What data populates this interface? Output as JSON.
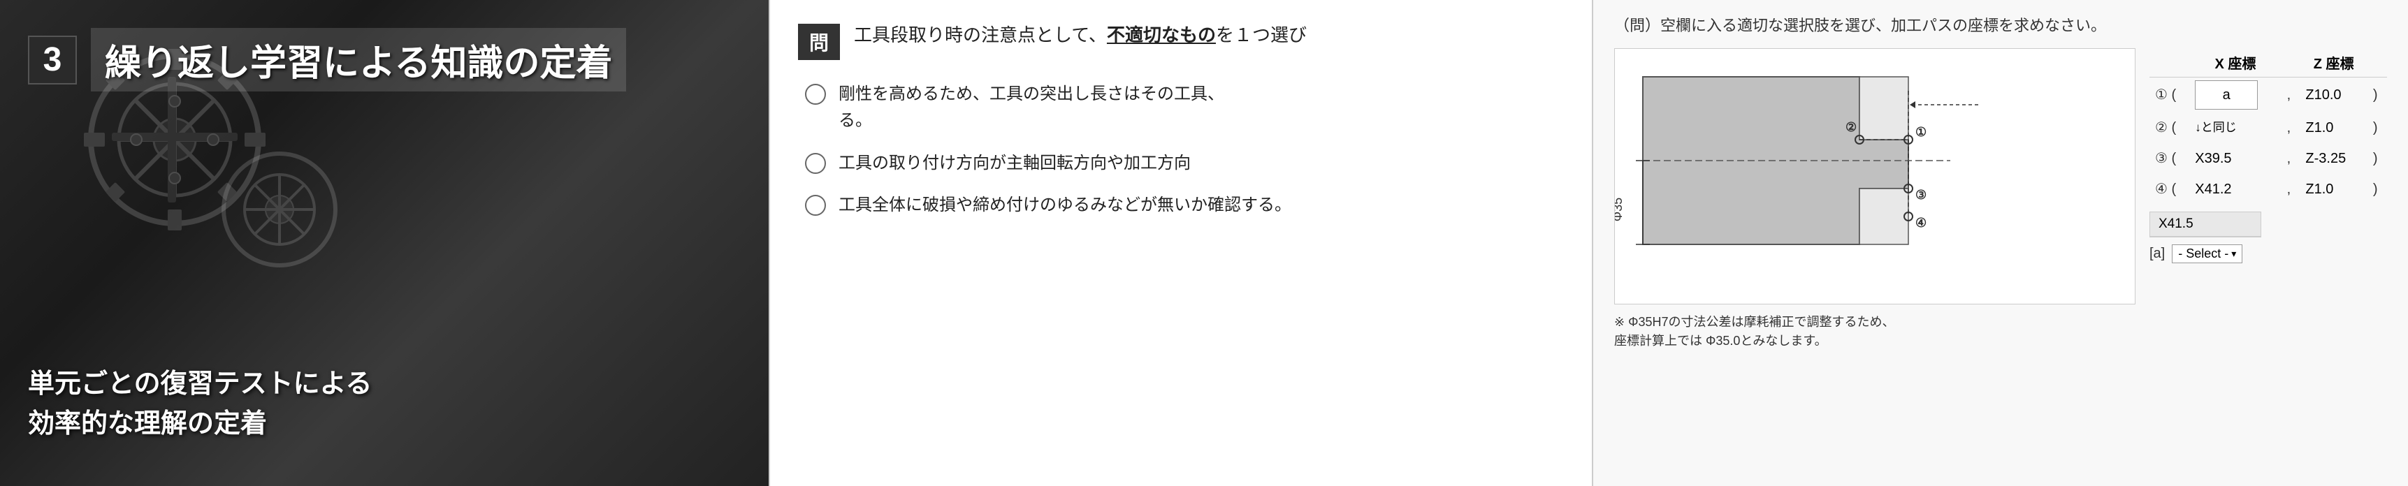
{
  "left": {
    "badge_number": "3",
    "title": "繰り返し学習による知識の定着",
    "bottom_line1": "単元ごとの復習テストによる",
    "bottom_line2": "効率的な理解の定着"
  },
  "middle": {
    "question_label": "問",
    "question_text": "工具段取り時の注意点として、不適切なものを１つ選び",
    "question_suffix": "",
    "options": [
      {
        "id": 1,
        "text": "剛性を高めるため、工具の突出し長さはその工具、\nる。"
      },
      {
        "id": 2,
        "text": "工具の取り付け方向が主軸回転方向や加工方向"
      },
      {
        "id": 3,
        "text": "工具全体に破損や締め付けのゆるみなどが無いか確認する。"
      }
    ]
  },
  "right": {
    "question_header": "（問）空欄に入る適切な選択肢を選び、加工パスの座標を求めなさい。",
    "col_x": "X 座標",
    "col_z": "Z 座標",
    "rows": [
      {
        "idx": "① (",
        "x_val": "a",
        "x_input": true,
        "z_val": "Z10.0",
        "z_input": false,
        "close": " )"
      },
      {
        "idx": "② (",
        "x_val": "↓と同じ",
        "x_input": false,
        "z_val": "Z1.0",
        "z_input": false,
        "close": " )"
      },
      {
        "idx": "③ (",
        "x_val": "X39.5",
        "x_input": false,
        "z_val": "Z-3.25",
        "z_input": false,
        "close": " )"
      },
      {
        "idx": "④ (",
        "x_val": "X41.2",
        "x_input": false,
        "z_val": "Z1.0",
        "z_input": false,
        "close": " )"
      }
    ],
    "dropdown_options": [
      "X41.5",
      "- Select -"
    ],
    "dropdown_label": "- Select -",
    "answer_label": "[a]",
    "note_line1": "※ Φ35H7の寸法公差は摩耗補正で調整するため、",
    "note_line2": "座標計算上では Φ35.0とみなします。",
    "phi_label": "Φ35",
    "point_labels": [
      "①",
      "②",
      "③",
      "④"
    ]
  }
}
